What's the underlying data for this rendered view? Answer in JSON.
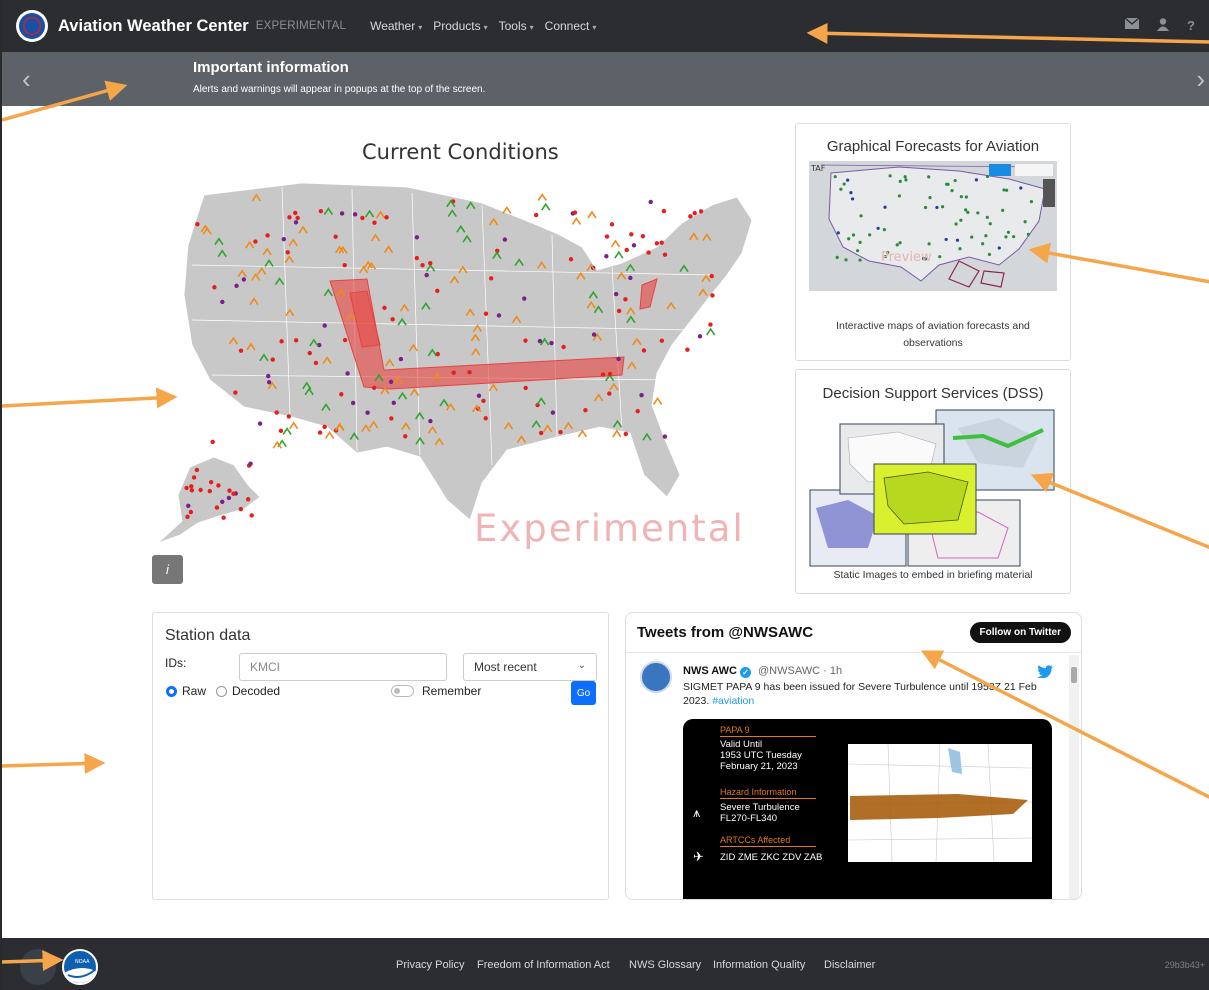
{
  "navbar": {
    "brand": "Aviation Weather Center",
    "brand_sub": "EXPERIMENTAL",
    "menus": [
      "Weather",
      "Products",
      "Tools",
      "Connect"
    ],
    "icons": [
      "mail-icon",
      "user-icon",
      "help-icon"
    ]
  },
  "banner": {
    "title": "Important information",
    "text": "Alerts and warnings will appear in popups at the top of the screen.",
    "prev": "‹",
    "next": "›"
  },
  "current_conditions": {
    "title": "Current Conditions",
    "watermark": "Experimental",
    "info_button": "i"
  },
  "gfa_card": {
    "title": "Graphical Forecasts for Aviation",
    "caption_line1": "Interactive maps of aviation forecasts and",
    "caption_line2": "observations",
    "thumb_label": "TAF",
    "thumb_watermark": "Preview"
  },
  "dss_card": {
    "title": "Decision Support Services (DSS)",
    "caption": "Static Images to embed in briefing material"
  },
  "station": {
    "title": "Station data",
    "ids_label": "IDs:",
    "ids_value": "KMCI",
    "range_selected": "Most recent",
    "radio_raw": "Raw",
    "radio_decoded": "Decoded",
    "remember": "Remember",
    "go": "Go"
  },
  "twitter": {
    "header": "Tweets from @NWSAWC",
    "follow": "Follow on Twitter",
    "name": "NWS AWC",
    "handle": "@NWSAWC · 1h",
    "text": "SIGMET PAPA 9 has been issued for Severe Turbulence until 1953Z 21 Feb 2023.",
    "hashtag": "#aviation",
    "card": {
      "head1": "PAPA 9",
      "valid1": "Valid Until",
      "valid2": "1953 UTC Tuesday",
      "valid3": "February 21, 2023",
      "head2": "Hazard Information",
      "hazard1": "Severe Turbulence",
      "hazard2": "FL270-FL340",
      "head3": "ARTCCs Affected",
      "artcc": "ZID ZME ZKC ZDV ZAB"
    }
  },
  "footer": {
    "links": [
      "Privacy Policy",
      "Freedom of Information Act",
      "NWS Glossary",
      "Information Quality",
      "Disclaimer"
    ],
    "version": "29b3b43+",
    "noaa_label": "NOAA"
  },
  "colors": {
    "navbar": "#2b2d31",
    "banner": "#5d6268",
    "accent_blue": "#0d6efd",
    "annotation_arrow": "#f5a54a",
    "sigmet_red": "#e8433f",
    "map_land": "#c8c8c8"
  }
}
